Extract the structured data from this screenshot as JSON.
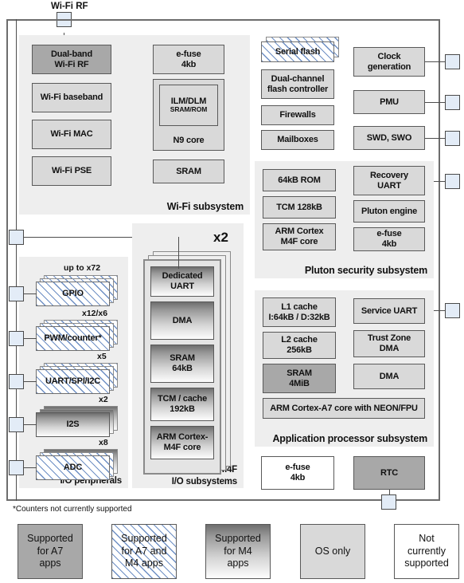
{
  "diagram": {
    "top_pin_label": "Wi-Fi RF",
    "footnote": "*Counters not currently supported"
  },
  "wifi_subsystem": {
    "label": "Wi-Fi subsystem",
    "blocks": [
      {
        "name": "dual-band-wifi-rf",
        "lines": [
          "Dual-band",
          "Wi-Fi RF"
        ],
        "fill": "a7"
      },
      {
        "name": "wifi-baseband",
        "lines": [
          "Wi-Fi baseband"
        ],
        "fill": "os"
      },
      {
        "name": "wifi-mac",
        "lines": [
          "Wi-Fi MAC"
        ],
        "fill": "os"
      },
      {
        "name": "wifi-pse",
        "lines": [
          "Wi-Fi PSE"
        ],
        "fill": "os"
      },
      {
        "name": "wifi-efuse",
        "lines": [
          "e-fuse",
          "4kb"
        ],
        "fill": "os"
      },
      {
        "name": "n9-core",
        "lines": [
          "N9 core"
        ],
        "fill": "os"
      },
      {
        "name": "ilm-dlm",
        "lines": [
          "ILM/DLM"
        ],
        "sub": "SRAM/ROM",
        "fill": "os"
      },
      {
        "name": "wifi-sram",
        "lines": [
          "SRAM"
        ],
        "fill": "os"
      }
    ]
  },
  "flash_group": {
    "blocks": [
      {
        "name": "serial-flash",
        "lines": [
          "Serial flash"
        ],
        "fill": "both",
        "stacked": true
      },
      {
        "name": "dual-channel-flash-controller",
        "lines": [
          "Dual-channel",
          "flash controller"
        ],
        "fill": "os"
      },
      {
        "name": "firewalls",
        "lines": [
          "Firewalls"
        ],
        "fill": "os"
      },
      {
        "name": "mailboxes",
        "lines": [
          "Mailboxes"
        ],
        "fill": "os"
      }
    ]
  },
  "system_services": {
    "blocks": [
      {
        "name": "clock-generation",
        "lines": [
          "Clock",
          "generation"
        ],
        "fill": "os"
      },
      {
        "name": "pmu",
        "lines": [
          "PMU"
        ],
        "fill": "os"
      },
      {
        "name": "swd-swo",
        "lines": [
          "SWD, SWO"
        ],
        "fill": "os"
      }
    ]
  },
  "pluton_subsystem": {
    "label": "Pluton security subsystem",
    "blocks": [
      {
        "name": "pluton-rom",
        "lines": [
          "64kB ROM"
        ],
        "fill": "os"
      },
      {
        "name": "pluton-tcm",
        "lines": [
          "TCM 128kB"
        ],
        "fill": "os"
      },
      {
        "name": "pluton-cortex-m4f-core",
        "lines": [
          "ARM Cortex",
          "M4F core"
        ],
        "fill": "os"
      },
      {
        "name": "recovery-uart",
        "lines": [
          "Recovery",
          "UART"
        ],
        "fill": "os"
      },
      {
        "name": "pluton-engine",
        "lines": [
          "Pluton engine"
        ],
        "fill": "os"
      },
      {
        "name": "pluton-efuse",
        "lines": [
          "e-fuse",
          "4kb"
        ],
        "fill": "os"
      }
    ]
  },
  "application_processor_subsystem": {
    "label": "Application processor subsystem",
    "blocks": [
      {
        "name": "l1-cache",
        "lines": [
          "L1 cache",
          "I:64kB / D:32kB"
        ],
        "fill": "os"
      },
      {
        "name": "l2-cache",
        "lines": [
          "L2 cache",
          "256kB"
        ],
        "fill": "os"
      },
      {
        "name": "ap-sram",
        "lines": [
          "SRAM",
          "4MiB"
        ],
        "fill": "a7"
      },
      {
        "name": "service-uart",
        "lines": [
          "Service UART"
        ],
        "fill": "os"
      },
      {
        "name": "trust-zone-dma",
        "lines": [
          "Trust Zone",
          "DMA"
        ],
        "fill": "os"
      },
      {
        "name": "ap-dma",
        "lines": [
          "DMA"
        ],
        "fill": "os"
      },
      {
        "name": "cortex-a7-core",
        "lines": [
          "ARM Cortex-A7 core with NEON/FPU"
        ],
        "fill": "os"
      }
    ]
  },
  "io_peripherals": {
    "label": "I/O peripherals",
    "blocks": [
      {
        "name": "gpio",
        "lines": [
          "GPIO"
        ],
        "multiplier": "up to x72",
        "fill": "both"
      },
      {
        "name": "pwm-counter",
        "lines": [
          "PWM/counter*"
        ],
        "multiplier": "x12/x6",
        "fill": "both"
      },
      {
        "name": "uart-spi-i2c",
        "lines": [
          "UART/SPI/I2C"
        ],
        "multiplier": "x5",
        "fill": "both"
      },
      {
        "name": "i2s",
        "lines": [
          "I2S"
        ],
        "multiplier": "x2",
        "fill": "m4"
      },
      {
        "name": "adc",
        "lines": [
          "ADC"
        ],
        "multiplier": "x8",
        "fill": "both"
      }
    ]
  },
  "cortex_m4f_io_subsystems": {
    "label_line1": "Cortex-M4F",
    "label_line2": "I/O subsystems",
    "multiplier": "x2",
    "blocks": [
      {
        "name": "dedicated-uart",
        "lines": [
          "Dedicated",
          "UART"
        ],
        "fill": "m4"
      },
      {
        "name": "m4-dma",
        "lines": [
          "DMA"
        ],
        "fill": "m4"
      },
      {
        "name": "m4-sram",
        "lines": [
          "SRAM",
          "64kB"
        ],
        "fill": "m4"
      },
      {
        "name": "tcm-cache",
        "lines": [
          "TCM / cache",
          "192kB"
        ],
        "fill": "m4"
      },
      {
        "name": "m4-core",
        "lines": [
          "ARM Cortex-",
          "M4F core"
        ],
        "fill": "m4"
      }
    ]
  },
  "bottom_blocks": [
    {
      "name": "bottom-efuse",
      "lines": [
        "e-fuse",
        "4kb"
      ],
      "fill": "none"
    },
    {
      "name": "rtc",
      "lines": [
        "RTC"
      ],
      "fill": "a7"
    }
  ],
  "legend": {
    "items": [
      {
        "name": "legend-a7",
        "lines": [
          "Supported",
          "for A7",
          "apps"
        ],
        "fill": "a7"
      },
      {
        "name": "legend-a7-m4",
        "lines": [
          "Supported",
          "for A7 and",
          "M4 apps"
        ],
        "fill": "both"
      },
      {
        "name": "legend-m4",
        "lines": [
          "Supported",
          "for M4",
          "apps"
        ],
        "fill": "m4"
      },
      {
        "name": "legend-os-only",
        "lines": [
          "OS only"
        ],
        "fill": "os"
      },
      {
        "name": "legend-not-supported",
        "lines": [
          "Not",
          "currently",
          "supported"
        ],
        "fill": "none"
      }
    ]
  },
  "colors": {
    "a7": "#a8a8a8",
    "os_only": "#d9d9d9",
    "not_supported": "#ffffff",
    "hatch": "#6e8fc4",
    "panel": "#eeeeee",
    "frame": "#6d6d6d",
    "pad": "#e3ecf7"
  }
}
